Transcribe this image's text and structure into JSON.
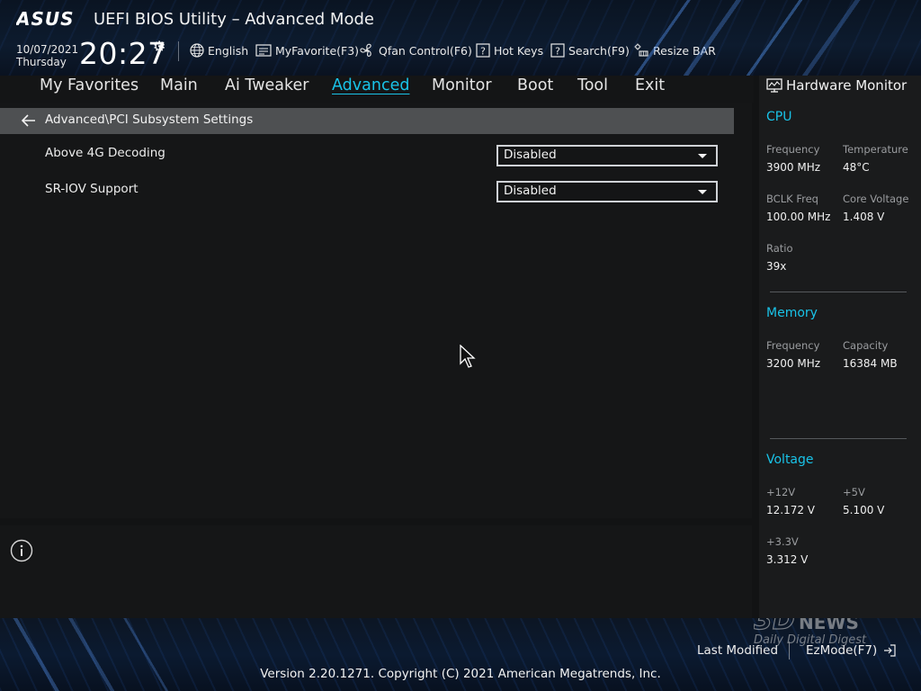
{
  "header": {
    "title": "UEFI BIOS Utility – Advanced Mode",
    "date": "10/07/2021",
    "weekday": "Thursday",
    "time": "20:27",
    "toolbar": {
      "language": "English",
      "myfavorite": "MyFavorite(F3)",
      "qfan": "Qfan Control(F6)",
      "hotkeys": "Hot Keys",
      "search": "Search(F9)",
      "resizebar": "Resize BAR"
    }
  },
  "nav": {
    "tabs": [
      {
        "label": "My Favorites"
      },
      {
        "label": "Main"
      },
      {
        "label": "Ai Tweaker"
      },
      {
        "label": "Advanced"
      },
      {
        "label": "Monitor"
      },
      {
        "label": "Boot"
      },
      {
        "label": "Tool"
      },
      {
        "label": "Exit"
      }
    ],
    "active": "Advanced"
  },
  "main": {
    "breadcrumb": "Advanced\\PCI Subsystem Settings",
    "settings": [
      {
        "label": "Above 4G Decoding",
        "value": "Disabled"
      },
      {
        "label": "SR-IOV Support",
        "value": "Disabled"
      }
    ]
  },
  "monitor": {
    "title": "Hardware Monitor",
    "cpu": {
      "heading": "CPU",
      "frequency_label": "Frequency",
      "frequency": "3900 MHz",
      "temperature_label": "Temperature",
      "temperature": "48°C",
      "bclk_label": "BCLK Freq",
      "bclk": "100.00 MHz",
      "corevolt_label": "Core Voltage",
      "corevolt": "1.408 V",
      "ratio_label": "Ratio",
      "ratio": "39x"
    },
    "memory": {
      "heading": "Memory",
      "frequency_label": "Frequency",
      "frequency": "3200 MHz",
      "capacity_label": "Capacity",
      "capacity": "16384 MB"
    },
    "voltage": {
      "heading": "Voltage",
      "v12_label": "+12V",
      "v12": "12.172 V",
      "v5_label": "+5V",
      "v5": "5.100 V",
      "v33_label": "+3.3V",
      "v33": "3.312 V"
    }
  },
  "footer": {
    "last_modified": "Last Modified",
    "ezmode": "EzMode(F7)",
    "copyright": "Version 2.20.1271. Copyright (C) 2021 American Megatrends, Inc."
  },
  "colors": {
    "accent": "#19c3e8",
    "breadcrumb_bg": "#4e5052",
    "panel_bg": "#151617"
  }
}
